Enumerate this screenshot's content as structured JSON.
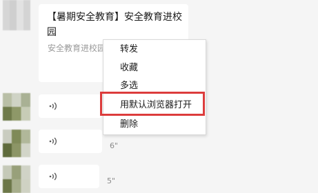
{
  "chat": {
    "link_card": {
      "title": "【暑期安全教育】安全教育进校园",
      "description": "安全教育进校园"
    },
    "voice_messages": [
      {
        "icon": "voice-wave-icon",
        "duration": ""
      },
      {
        "icon": "voice-wave-icon",
        "duration": "6\""
      },
      {
        "icon": "voice-wave-icon",
        "duration": "5\""
      }
    ]
  },
  "context_menu": {
    "items": [
      {
        "label": "转发"
      },
      {
        "label": "收藏"
      },
      {
        "label": "多选"
      },
      {
        "label": "用默认浏览器打开",
        "highlighted": true
      },
      {
        "label": "删除"
      }
    ],
    "highlight_color": "#dc3c3c"
  }
}
